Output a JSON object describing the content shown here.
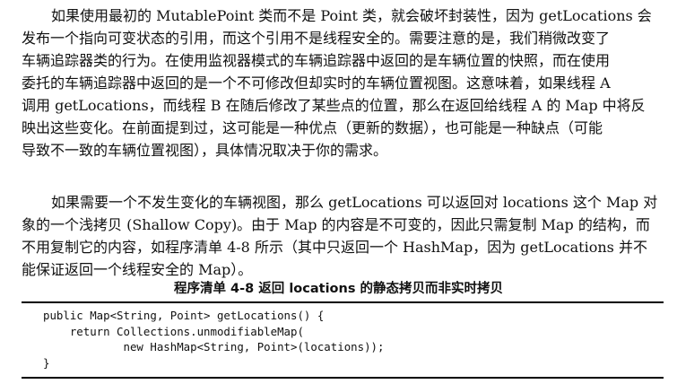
{
  "paragraph1": {
    "lines": [
      "如果使用最初的 MutablePoint 类而不是 Point 类，就会破坏封装性，因为 getLocations 会",
      "发布一个指向可变状态的引用，而这个引用不是线程安全的。需要注意的是，我们稍微改变了",
      "车辆追踪器类的行为。在使用监视器模式的车辆追踪器中返回的是车辆位置的快照，而在使用",
      "委托的车辆追踪器中返回的是一个不可修改但却实时的车辆位置视图。这意味着，如果线程 A",
      "调用 getLocations，而线程 B 在随后修改了某些点的位置，那么在返回给线程 A 的 Map 中将反",
      "映出这些变化。在前面提到过，这可能是一种优点（更新的数据），也可能是一种缺点（可能",
      "导致不一致的车辆位置视图），具体情况取决于你的需求。"
    ]
  },
  "paragraph2": {
    "lines": [
      "如果需要一个不发生变化的车辆视图，那么 getLocations 可以返回对 locations 这个 Map 对",
      "象的一个浅拷贝 (Shallow Copy)。由于 Map 的内容是不可变的，因此只需复制 Map 的结构，而",
      "不用复制它的内容，如程序清单 4-8 所示（其中只返回一个 HashMap，因为 getLocations 并不",
      "能保证返回一个线程安全的 Map）。"
    ]
  },
  "listing": {
    "title": "程序清单 4-8    返回 locations 的静态拷贝而非实时拷贝",
    "code_lines": [
      "public Map<String, Point> getLocations() {",
      "    return Collections.unmodifiableMap(",
      "            new HashMap<String, Point>(locations));",
      "}"
    ]
  }
}
